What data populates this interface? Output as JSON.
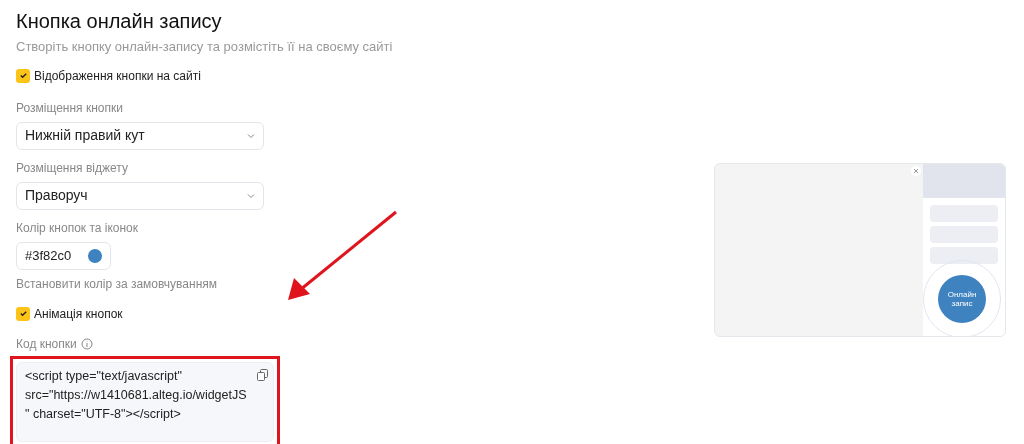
{
  "title": "Кнопка онлайн запису",
  "subtitle": "Створіть кнопку онлайн-запису та розмістіть її на своєму сайті",
  "show_on_site": {
    "label": "Відображення кнопки на сайті",
    "checked": true
  },
  "button_position": {
    "label": "Розміщення кнопки",
    "value": "Нижній правий кут"
  },
  "widget_position": {
    "label": "Розміщення віджету",
    "value": "Праворуч"
  },
  "button_color": {
    "label": "Колір кнопок та іконок",
    "value": "#3f82c0",
    "color": "#3f82c0"
  },
  "reset_color_link": "Встановити колір за замовчуванням",
  "animation": {
    "label": "Анімація кнопок",
    "checked": true
  },
  "code": {
    "label": "Код кнопки",
    "value": "<script type=\"text/javascript\" src=\"https://w1410681.alteg.io/widgetJS\" charset=\"UTF-8\"></script>"
  },
  "preview": {
    "button_label": "Онлайн запис"
  }
}
